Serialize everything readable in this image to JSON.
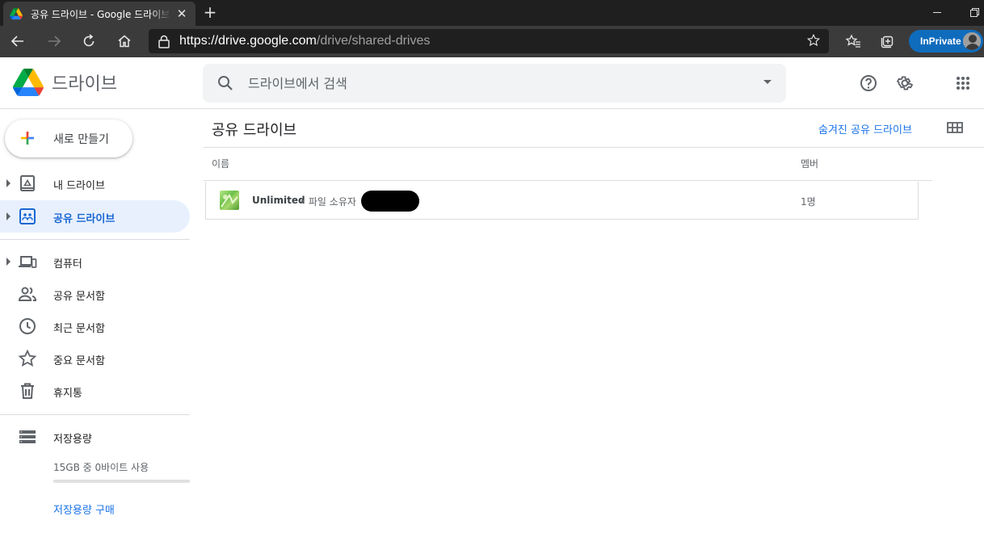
{
  "browser": {
    "tab_title": "공유 드라이브 - Google 드라이브",
    "url_host": "https://drive.google.com",
    "url_path": "/drive/shared-drives",
    "inprivate_label": "InPrivate"
  },
  "header": {
    "logo_text": "드라이브",
    "search_placeholder": "드라이브에서 검색"
  },
  "sidebar": {
    "new_label": "새로 만들기",
    "items": [
      {
        "label": "내 드라이브"
      },
      {
        "label": "공유 드라이브"
      },
      {
        "label": "컴퓨터"
      },
      {
        "label": "공유 문서함"
      },
      {
        "label": "최근 문서함"
      },
      {
        "label": "중요 문서함"
      },
      {
        "label": "휴지통"
      },
      {
        "label": "저장용량"
      }
    ],
    "storage_text": "15GB 중 0바이트 사용",
    "storage_used_fraction": 0,
    "buy_storage": "저장용량 구매"
  },
  "main": {
    "title": "공유 드라이브",
    "hidden_link": "숨겨진 공유 드라이브",
    "columns": {
      "name": "이름",
      "members": "멤버"
    },
    "rows": [
      {
        "name": "Unlimited",
        "owner_prefix": "• 파일 소유자",
        "members": "1명"
      }
    ]
  }
}
